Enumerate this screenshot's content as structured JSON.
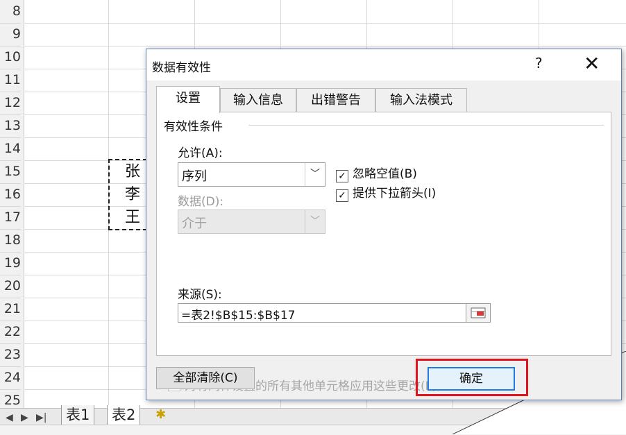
{
  "sheet": {
    "row_numbers": [
      "8",
      "9",
      "10",
      "11",
      "12",
      "13",
      "14",
      "15",
      "16",
      "17",
      "18",
      "19",
      "20",
      "21",
      "22",
      "23",
      "24",
      "25"
    ],
    "cells": [
      "张",
      "李",
      "王"
    ],
    "tabs": [
      "表1",
      "表2"
    ]
  },
  "dialog": {
    "title": "数据有效性",
    "help": "?",
    "close": "✕",
    "tabs": [
      "设置",
      "输入信息",
      "出错警告",
      "输入法模式"
    ],
    "group_label": "有效性条件",
    "allow_label": "允许(A):",
    "allow_value": "序列",
    "data_label": "数据(D):",
    "data_value": "介于",
    "ignore_blank": "忽略空值(B)",
    "dropdown": "提供下拉箭头(I)",
    "source_label": "来源(S):",
    "source_value": "=表2!$B$15:$B$17",
    "apply_all": "对有同样设置的所有其他单元格应用这些更改(P)",
    "clear_all": "全部清除(C)",
    "ok": "确定"
  },
  "colors": {
    "highlight": "#e0141e",
    "ok_border": "#1d7be3"
  }
}
